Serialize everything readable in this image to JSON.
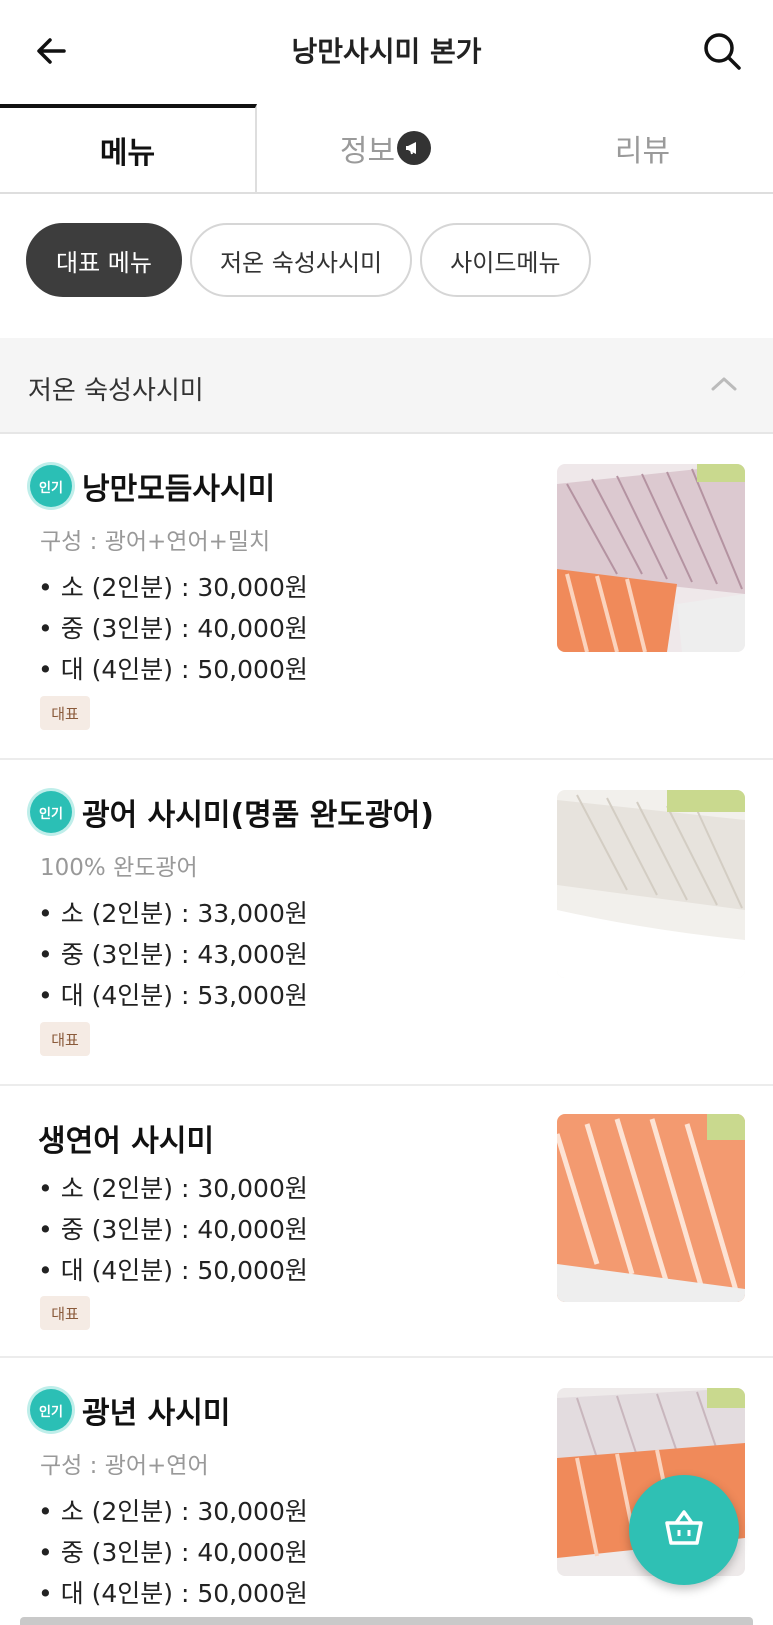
{
  "header": {
    "title": "낭만사시미 본가",
    "back_icon": "arrow-left-icon",
    "search_icon": "search-icon"
  },
  "tabs": [
    {
      "label": "메뉴",
      "active": true
    },
    {
      "label": "정보",
      "active": false,
      "icon": "megaphone-icon"
    },
    {
      "label": "리뷰",
      "active": false
    }
  ],
  "chips": [
    {
      "label": "대표 메뉴",
      "active": true
    },
    {
      "label": "저온 숙성사시미",
      "active": false
    },
    {
      "label": "사이드메뉴",
      "active": false
    }
  ],
  "section": {
    "title": "저온 숙성사시미",
    "toggle_icon": "chevron-up-icon"
  },
  "badge_popular": "인기",
  "badge_rep": "대표",
  "items": [
    {
      "name": "낭만모듬사시미",
      "desc": "구성 : 광어+연어+밀치",
      "prices": [
        "• 소 (2인분) : 30,000원",
        "• 중 (3인분) : 40,000원",
        "• 대 (4인분) : 50,000원"
      ]
    },
    {
      "name": "광어 사시미(명품 완도광어)",
      "desc": "100% 완도광어",
      "prices": [
        "• 소 (2인분) : 33,000원",
        "• 중 (3인분) : 43,000원",
        "• 대 (4인분) : 53,000원"
      ]
    },
    {
      "name": "생연어 사시미",
      "prices": [
        "• 소 (2인분) : 30,000원",
        "• 중 (3인분) : 40,000원",
        "• 대 (4인분) : 50,000원"
      ]
    },
    {
      "name": "광년 사시미",
      "desc": "구성 : 광어+연어",
      "prices": [
        "• 소 (2인분) : 30,000원",
        "• 중 (3인분) : 40,000원",
        "• 대 (4인분) : 50,000원"
      ]
    }
  ],
  "cart_icon": "basket-icon",
  "colors": {
    "accent": "#2fc0b4",
    "chip_active": "#3d3d3d"
  }
}
